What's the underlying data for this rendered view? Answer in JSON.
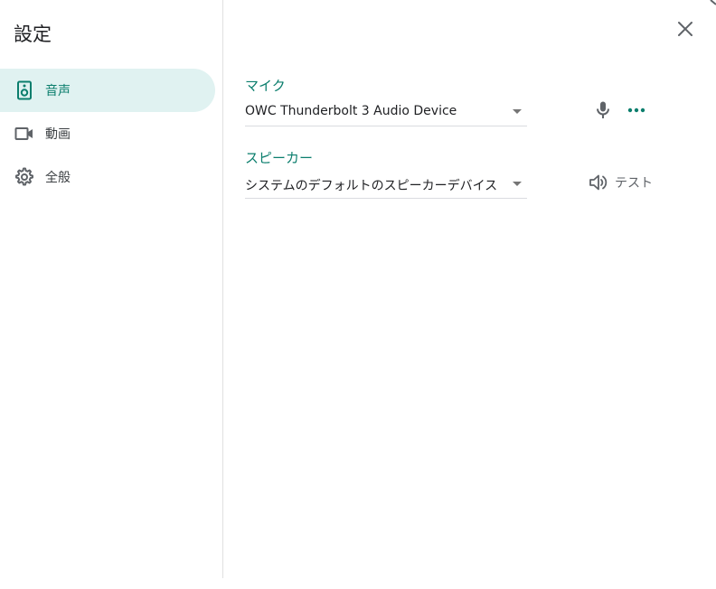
{
  "dialog": {
    "title": "設定"
  },
  "sidebar": {
    "items": [
      {
        "label": "音声",
        "icon": "speaker-icon",
        "active": true
      },
      {
        "label": "動画",
        "icon": "video-camera-icon",
        "active": false
      },
      {
        "label": "全般",
        "icon": "gear-icon",
        "active": false
      }
    ]
  },
  "audio": {
    "microphone": {
      "label": "マイク",
      "selected": "OWC Thunderbolt 3 Audio Device"
    },
    "speaker": {
      "label": "スピーカー",
      "selected": "システムのデフォルトのスピーカーデバイス",
      "test_label": "テスト"
    }
  },
  "colors": {
    "accent": "#0b7e6d",
    "active_bg": "#e0f2f1",
    "icon_gray": "#5f6368"
  }
}
